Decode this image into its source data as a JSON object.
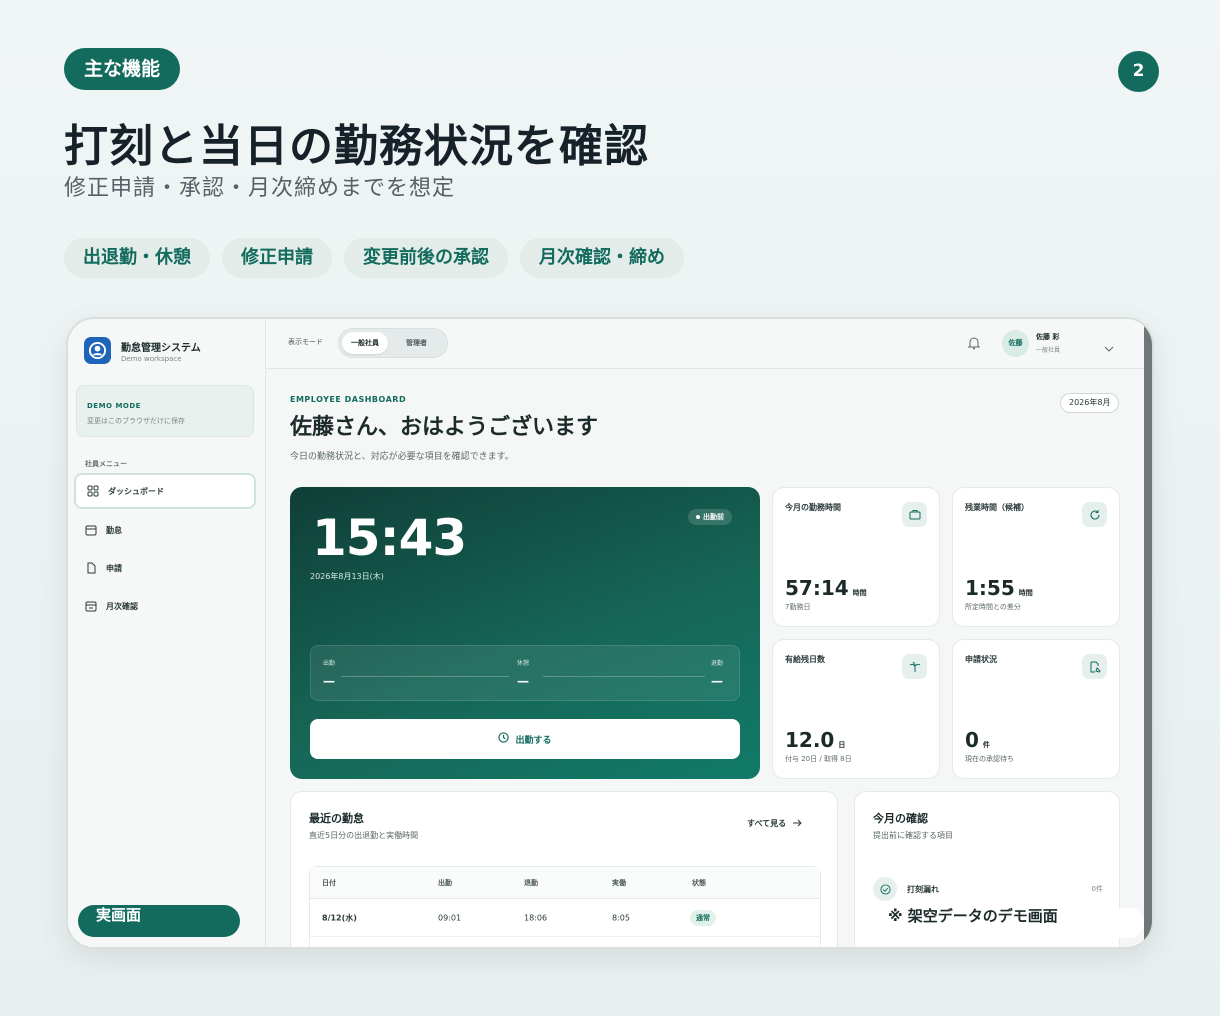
{
  "slide": {
    "label": "主な機能",
    "page_number": "2",
    "title": "打刻と当日の勤務状況を確認",
    "subtitle": "修正申請・承認・月次締めまでを想定",
    "tags": [
      "出退勤・休憩",
      "修正申請",
      "変更前後の承認",
      "月次確認・締め"
    ]
  },
  "app": {
    "name": "勤怠管理システム",
    "workspace": "Demo workspace",
    "demo_title": "DEMO MODE",
    "demo_sub": "変更はこのブラウザだけに保存",
    "menu_label": "社員メニュー",
    "menu": [
      {
        "label": "ダッシュボード",
        "icon": "grid-icon"
      },
      {
        "label": "勤怠",
        "icon": "calendar-icon"
      },
      {
        "label": "申請",
        "icon": "document-icon"
      },
      {
        "label": "月次確認",
        "icon": "calendar-check-icon"
      }
    ],
    "sidebar_badge": "実画面"
  },
  "topbar": {
    "mode_label": "表示モード",
    "mode_on": "一般社員",
    "mode_off": "管理者",
    "avatar": "佐藤",
    "user_name": "佐藤 彩",
    "user_role": "一般社員"
  },
  "dashboard": {
    "eyebrow": "EMPLOYEE DASHBOARD",
    "greeting": "佐藤さん、おはようございます",
    "greeting_sub": "今日の勤務状況と、対応が必要な項目を確認できます。",
    "month": "2026年8月",
    "clock": {
      "time": "15:43",
      "date": "2026年8月13日(木)",
      "status": "出勤前",
      "in_label": "出勤",
      "break_label": "休憩",
      "out_label": "退勤",
      "in_value": "—",
      "break_value": "—",
      "out_value": "—",
      "button": "出勤する"
    },
    "stats": [
      {
        "title": "今月の勤務時間",
        "value": "57:14",
        "unit": "時間",
        "note": "7勤務日",
        "icon": "briefcase-icon"
      },
      {
        "title": "残業時間（候補）",
        "value": "1:55",
        "unit": "時間",
        "note": "所定時間との差分",
        "icon": "refresh-icon"
      },
      {
        "title": "有給残日数",
        "value": "12.0",
        "unit": "日",
        "note": "付与 20日 / 取得 8日",
        "icon": "palm-icon"
      },
      {
        "title": "申請状況",
        "value": "0",
        "unit": "件",
        "note": "現在の承認待ち",
        "icon": "edit-icon"
      }
    ],
    "recent": {
      "title": "最近の勤怠",
      "sub": "直近5日分の出退勤と実働時間",
      "see_all": "すべて見る",
      "headers": [
        "日付",
        "出勤",
        "退勤",
        "実働",
        "状態"
      ],
      "rows": [
        {
          "date": "8/12(水)",
          "in": "09:01",
          "out": "18:06",
          "work": "8:05",
          "status": "通常"
        }
      ]
    },
    "checks": {
      "title": "今月の確認",
      "sub": "提出前に確認する項目",
      "items": [
        {
          "label": "打刻漏れ",
          "count": "0件"
        }
      ]
    }
  },
  "demo_note": "※ 架空データのデモ画面",
  "colors": {
    "brand": "#136b5e",
    "accent_bg": "#e3ece9"
  }
}
